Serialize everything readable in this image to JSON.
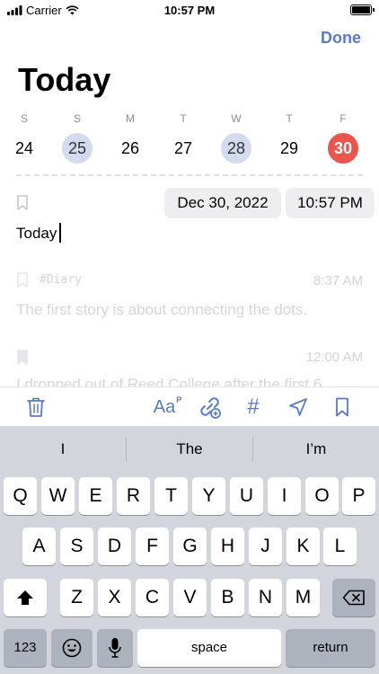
{
  "status_bar": {
    "carrier": "Carrier",
    "time": "10:57 PM"
  },
  "header": {
    "done_label": "Done",
    "title": "Today"
  },
  "week": {
    "days": [
      {
        "letter": "S",
        "number": "24",
        "state": "normal"
      },
      {
        "letter": "S",
        "number": "25",
        "state": "highlighted"
      },
      {
        "letter": "M",
        "number": "26",
        "state": "normal"
      },
      {
        "letter": "T",
        "number": "27",
        "state": "normal"
      },
      {
        "letter": "W",
        "number": "28",
        "state": "highlighted"
      },
      {
        "letter": "T",
        "number": "29",
        "state": "normal"
      },
      {
        "letter": "F",
        "number": "30",
        "state": "today"
      }
    ]
  },
  "entry": {
    "date": "Dec 30, 2022",
    "time": "10:57 PM",
    "text": "Today"
  },
  "faded_entries": [
    {
      "tag": "#Diary",
      "time": "8:37 AM",
      "text": "The first story is about connecting the dots."
    },
    {
      "time": "12:00 AM",
      "text": "I dropped out of Reed College after the first 6"
    }
  ],
  "toolbar": {
    "format_label": "Aa",
    "format_sup": "P",
    "hash_label": "#"
  },
  "keyboard": {
    "suggestions": [
      "I",
      "The",
      "I’m"
    ],
    "row1": [
      "Q",
      "W",
      "E",
      "R",
      "T",
      "Y",
      "U",
      "I",
      "O",
      "P"
    ],
    "row2": [
      "A",
      "S",
      "D",
      "F",
      "G",
      "H",
      "J",
      "K",
      "L"
    ],
    "row3": [
      "Z",
      "X",
      "C",
      "V",
      "B",
      "N",
      "M"
    ],
    "numbers_label": "123",
    "space_label": "space",
    "return_label": "return"
  },
  "colors": {
    "accent": "#5b7bc4",
    "today": "#e8564d",
    "highlight": "#d4dbef",
    "faded_text": "#d6d6da"
  },
  "icons": [
    "signal-icon",
    "wifi-icon",
    "battery-icon",
    "bookmark-icon",
    "trash-icon",
    "link-add-icon",
    "location-arrow-icon",
    "emoji-icon",
    "microphone-icon",
    "shift-icon",
    "backspace-icon"
  ]
}
